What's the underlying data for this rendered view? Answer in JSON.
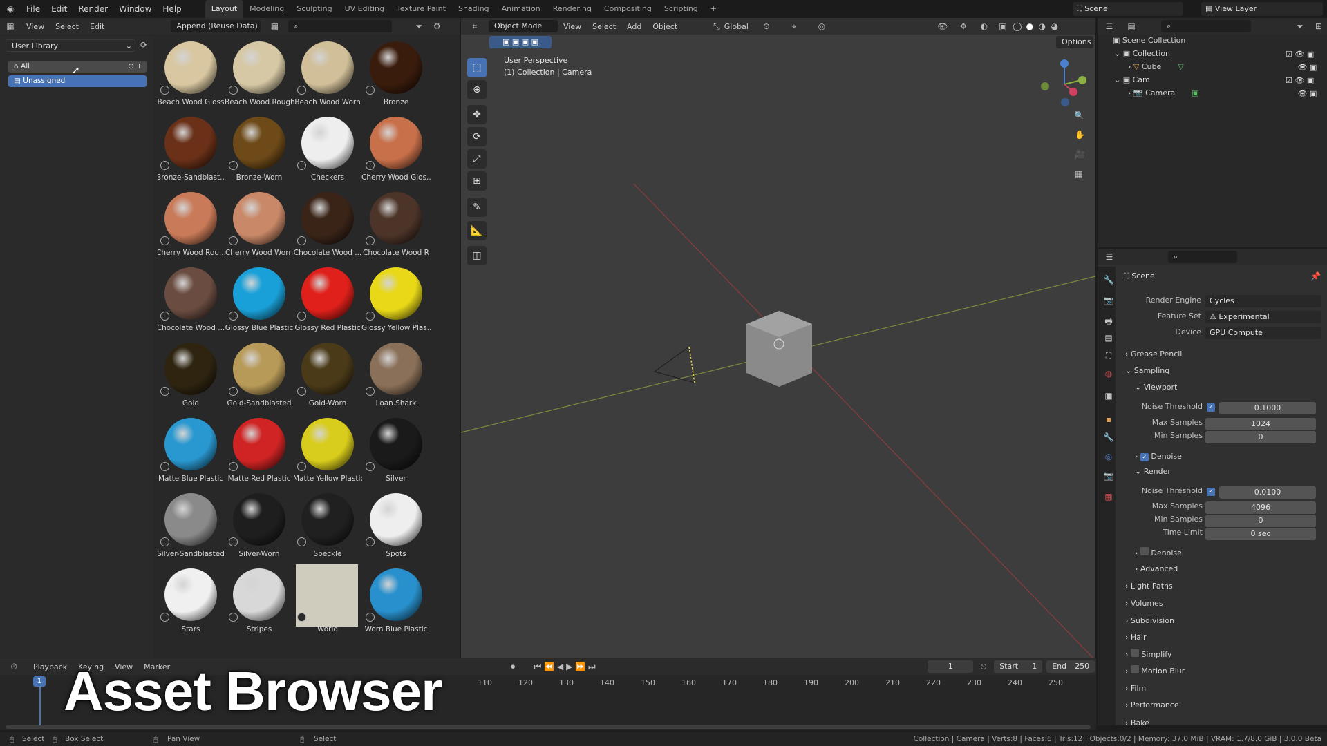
{
  "topbar": {
    "menus": [
      "File",
      "Edit",
      "Render",
      "Window",
      "Help"
    ],
    "workspaces": [
      "Layout",
      "Modeling",
      "Sculpting",
      "UV Editing",
      "Texture Paint",
      "Shading",
      "Animation",
      "Rendering",
      "Compositing",
      "Scripting"
    ],
    "active_workspace": "Layout",
    "plus": "+",
    "scene": "Scene",
    "view_layer": "View Layer"
  },
  "asset_browser": {
    "menus": [
      "View",
      "Select",
      "Edit"
    ],
    "library": "User Library",
    "import_mode": "Append (Reuse Data)",
    "catalogs": [
      "All",
      "Unassigned"
    ],
    "assets": [
      {
        "name": "Beach Wood Gloss",
        "color": "#d8c7a0"
      },
      {
        "name": "Beach Wood Rough",
        "color": "#d6c8a4"
      },
      {
        "name": "Beach Wood Worn",
        "color": "#d0bf98"
      },
      {
        "name": "Bronze",
        "color": "#3a1c0c"
      },
      {
        "name": "Bronze-Sandblast...",
        "color": "#6a3018"
      },
      {
        "name": "Bronze-Worn",
        "color": "#6e4a18"
      },
      {
        "name": "Checkers",
        "color": "#eeeeee"
      },
      {
        "name": "Cherry Wood Glos...",
        "color": "#c8704a"
      },
      {
        "name": "Cherry Wood Rou...",
        "color": "#c97a58"
      },
      {
        "name": "Cherry Wood Worn",
        "color": "#c98868"
      },
      {
        "name": "Chocolate Wood ...",
        "color": "#3a2418"
      },
      {
        "name": "Chocolate Wood R",
        "color": "#4c3428"
      },
      {
        "name": "Chocolate Wood ...",
        "color": "#6a4c40"
      },
      {
        "name": "Glossy Blue Plastic",
        "color": "#1aa0d8"
      },
      {
        "name": "Glossy Red Plastic",
        "color": "#e0201a"
      },
      {
        "name": "Glossy Yellow Plas...",
        "color": "#e8d818"
      },
      {
        "name": "Gold",
        "color": "#2e2410"
      },
      {
        "name": "Gold-Sandblasted",
        "color": "#b89a58"
      },
      {
        "name": "Gold-Worn",
        "color": "#4a3a18"
      },
      {
        "name": "Loan.Shark",
        "color": "#8a7058"
      },
      {
        "name": "Matte Blue Plastic",
        "color": "#2a98d0"
      },
      {
        "name": "Matte Red Plastic",
        "color": "#d02424"
      },
      {
        "name": "Matte Yellow Plastic",
        "color": "#d8cc1c"
      },
      {
        "name": "Silver",
        "color": "#1a1a1a"
      },
      {
        "name": "Silver-Sandblasted",
        "color": "#8a8a8a"
      },
      {
        "name": "Silver-Worn",
        "color": "#1e1e1e"
      },
      {
        "name": "Speckle",
        "color": "#202020"
      },
      {
        "name": "Spots",
        "color": "#eeeeee"
      },
      {
        "name": "Stars",
        "color": "#f0f0f0"
      },
      {
        "name": "Stripes",
        "color": "#d8d8d8"
      },
      {
        "name": "World",
        "color": "#cfcbbd"
      },
      {
        "name": "Worn Blue Plastic",
        "color": "#2890cc"
      }
    ]
  },
  "viewport": {
    "mode": "Object Mode",
    "menus": [
      "View",
      "Select",
      "Add",
      "Object"
    ],
    "orientation": "Global",
    "options": "Options",
    "perspective": "User Perspective",
    "context": "(1) Collection | Camera"
  },
  "outliner": {
    "root": "Scene Collection",
    "items": [
      {
        "name": "Collection"
      },
      {
        "name": "Cube"
      },
      {
        "name": "Cam"
      },
      {
        "name": "Camera"
      }
    ]
  },
  "properties": {
    "context": "Scene",
    "render_engine_label": "Render Engine",
    "render_engine": "Cycles",
    "feature_set_label": "Feature Set",
    "feature_set": "Experimental",
    "device_label": "Device",
    "device": "GPU Compute",
    "sections": {
      "grease_pencil": "Grease Pencil",
      "sampling": "Sampling",
      "viewport": "Viewport",
      "denoise": "Denoise",
      "render": "Render",
      "advanced": "Advanced",
      "light_paths": "Light Paths",
      "volumes": "Volumes",
      "subdivision": "Subdivision",
      "hair": "Hair",
      "simplify": "Simplify",
      "motion_blur": "Motion Blur",
      "film": "Film",
      "performance": "Performance",
      "bake": "Bake"
    },
    "labels": {
      "noise_threshold": "Noise Threshold",
      "max_samples": "Max Samples",
      "min_samples": "Min Samples",
      "time_limit": "Time Limit"
    },
    "viewport_values": {
      "noise_threshold": "0.1000",
      "max_samples": "1024",
      "min_samples": "0"
    },
    "render_values": {
      "noise_threshold": "0.0100",
      "max_samples": "4096",
      "min_samples": "0",
      "time_limit": "0 sec"
    }
  },
  "timeline": {
    "menus": [
      "Playback",
      "Keying",
      "View",
      "Marker"
    ],
    "current_frame": "1",
    "start_label": "Start",
    "start": "1",
    "end_label": "End",
    "end": "250",
    "ticks": [
      "110",
      "120",
      "130",
      "140",
      "150",
      "160",
      "170",
      "180",
      "190",
      "200",
      "210",
      "220",
      "230",
      "240",
      "250"
    ],
    "frame_marker": "1"
  },
  "overlay_title": "Asset Browser",
  "statusbar": {
    "select": "Select",
    "box_select": "Box Select",
    "pan_view": "Pan View",
    "select2": "Select",
    "info": "Collection | Camera | Verts:8 | Faces:6 | Tris:12 | Objects:0/2 | Memory: 37.0 MiB | VRAM: 1.7/8.0 GiB | 3.0.0 Beta"
  }
}
